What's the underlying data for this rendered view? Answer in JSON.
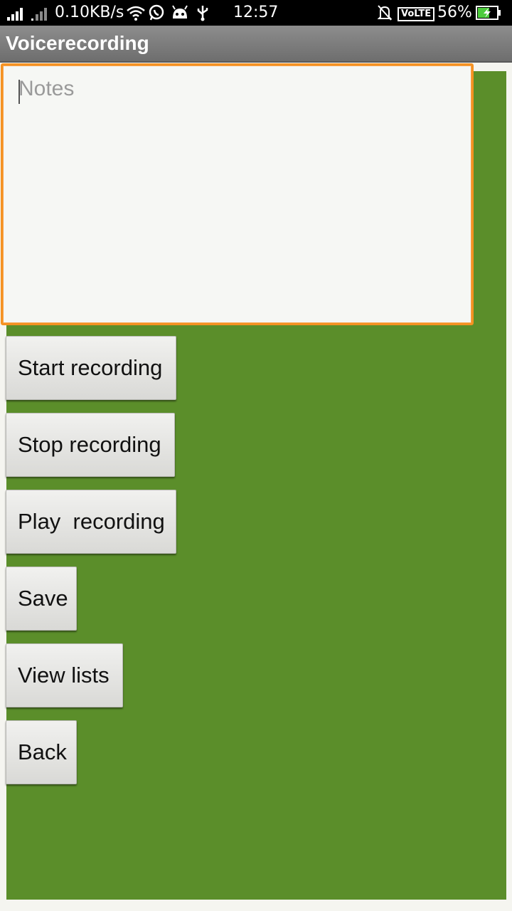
{
  "status_bar": {
    "net_speed": "0.10KB/s",
    "time": "12:57",
    "network_type": "VoLTE",
    "battery": "56%",
    "icons": [
      "signal-icon",
      "signal-icon-2",
      "wifi-icon",
      "whatsapp-icon",
      "android-icon",
      "usb-icon",
      "mute-icon",
      "battery-charging-icon"
    ]
  },
  "app": {
    "title": "Voicerecording"
  },
  "notes": {
    "placeholder": "Notes",
    "value": ""
  },
  "buttons": {
    "start": "Start recording",
    "stop": "Stop recording",
    "play": "Play  recording",
    "save": "Save",
    "view_lists": "View lists",
    "back": "Back"
  },
  "colors": {
    "background_green": "#5b8e2a",
    "focus_orange": "#f59222",
    "title_bar_gray": "#7d7d7d"
  }
}
